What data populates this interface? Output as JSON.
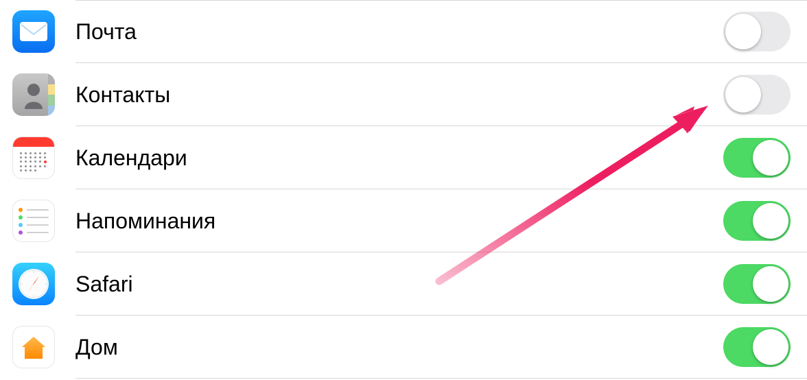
{
  "colors": {
    "toggle_on": "#4cd964",
    "toggle_off": "#e9e9ec",
    "arrow": "#ed1e60"
  },
  "rows": [
    {
      "id": "mail",
      "label": "Почта",
      "icon": "mail-icon",
      "enabled": false
    },
    {
      "id": "contacts",
      "label": "Контакты",
      "icon": "contacts-icon",
      "enabled": false
    },
    {
      "id": "calendars",
      "label": "Календари",
      "icon": "calendar-icon",
      "enabled": true
    },
    {
      "id": "reminders",
      "label": "Напоминания",
      "icon": "reminders-icon",
      "enabled": true
    },
    {
      "id": "safari",
      "label": "Safari",
      "icon": "safari-icon",
      "enabled": true
    },
    {
      "id": "home",
      "label": "Дом",
      "icon": "home-icon",
      "enabled": true
    }
  ]
}
